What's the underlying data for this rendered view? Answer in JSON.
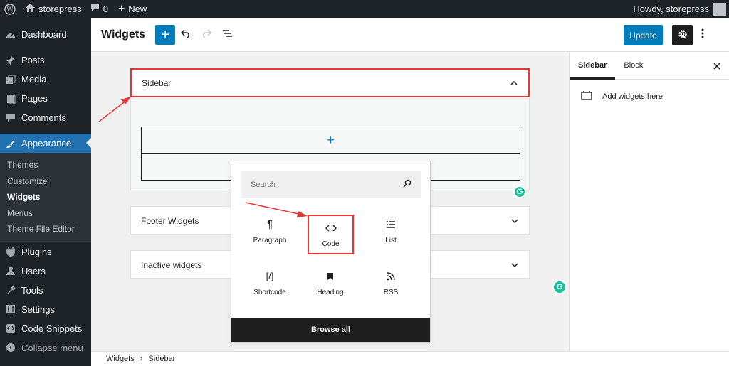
{
  "adminbar": {
    "site_name": "storepress",
    "comments_count": "0",
    "new_label": "New",
    "howdy": "Howdy, storepress"
  },
  "menu": {
    "items_top": [
      {
        "label": "Dashboard",
        "icon": "dashboard-icon"
      },
      {
        "label": "Posts",
        "icon": "pin-icon"
      },
      {
        "label": "Media",
        "icon": "media-icon"
      },
      {
        "label": "Pages",
        "icon": "pages-icon"
      },
      {
        "label": "Comments",
        "icon": "comment-icon"
      }
    ],
    "active": {
      "label": "Appearance",
      "icon": "brush-icon"
    },
    "submenu": [
      "Themes",
      "Customize",
      "Widgets",
      "Menus",
      "Theme File Editor"
    ],
    "current_sub": "Widgets",
    "items_bottom": [
      {
        "label": "Plugins",
        "icon": "plugin-icon"
      },
      {
        "label": "Users",
        "icon": "users-icon"
      },
      {
        "label": "Tools",
        "icon": "wrench-icon"
      },
      {
        "label": "Settings",
        "icon": "settings-icon"
      },
      {
        "label": "Code Snippets",
        "icon": "code-snippets-icon"
      },
      {
        "label": "Collapse menu",
        "icon": "collapse-icon"
      }
    ]
  },
  "header": {
    "title": "Widgets",
    "update_label": "Update"
  },
  "canvas": {
    "sidebar_title": "Sidebar",
    "footer_widgets_title": "Footer Widgets",
    "inactive_title": "Inactive widgets"
  },
  "inserter": {
    "search_placeholder": "Search",
    "blocks": [
      {
        "label": "Paragraph",
        "icon": "paragraph-icon"
      },
      {
        "label": "Code",
        "icon": "code-icon"
      },
      {
        "label": "List",
        "icon": "list-icon"
      },
      {
        "label": "Shortcode",
        "icon": "shortcode-icon"
      },
      {
        "label": "Heading",
        "icon": "heading-icon"
      },
      {
        "label": "RSS",
        "icon": "rss-icon"
      }
    ],
    "browse_all": "Browse all"
  },
  "settings_sidebar": {
    "tabs": [
      "Sidebar",
      "Block"
    ],
    "active_tab": "Sidebar",
    "message": "Add widgets here."
  },
  "breadcrumb": {
    "items": [
      "Widgets",
      "Sidebar"
    ],
    "separator": "›"
  },
  "colors": {
    "admin_dark": "#1d2327",
    "accent_blue": "#007cba",
    "menu_active": "#2271b1",
    "annotation_red": "#e33333",
    "grammarly_green": "#15c39a"
  }
}
